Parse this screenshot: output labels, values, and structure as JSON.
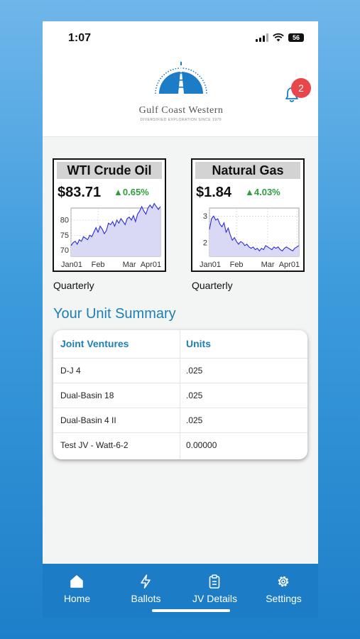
{
  "status_bar": {
    "time": "1:07",
    "battery": "56"
  },
  "header": {
    "logo_name": "Gulf Coast Western",
    "logo_tagline": "DIVERSIFIED EXPLORATION SINCE 1970",
    "notification_count": "2"
  },
  "commodities": [
    {
      "title": "WTI Crude Oil",
      "price": "$83.71",
      "change": "▲0.65%",
      "period": "Quarterly",
      "chart_data": {
        "type": "area",
        "x_tick_labels": [
          "Jan01",
          "Feb",
          "Mar",
          "Apr01"
        ],
        "y_tick_labels": [
          "70",
          "75",
          "80"
        ],
        "ylim": [
          68,
          84
        ],
        "x": [
          "Jan01",
          "",
          "",
          "",
          "",
          "",
          "",
          "",
          "",
          "",
          "",
          "",
          "",
          "Feb",
          "",
          "",
          "",
          "",
          "",
          "",
          "",
          "",
          "",
          "",
          "",
          "",
          "",
          "",
          "Mar",
          "",
          "",
          "",
          "",
          "",
          "",
          "",
          "",
          "",
          "",
          "",
          "",
          "",
          "Apr01"
        ],
        "values": [
          71.5,
          72.5,
          73.0,
          72.0,
          73.5,
          73.0,
          74.5,
          74.0,
          73.5,
          75.0,
          74.5,
          76.0,
          77.5,
          76.0,
          78.0,
          77.0,
          75.5,
          76.5,
          79.0,
          78.5,
          79.5,
          78.0,
          80.0,
          79.0,
          80.5,
          79.5,
          78.5,
          80.5,
          81.0,
          80.0,
          81.5,
          79.5,
          82.0,
          83.0,
          84.5,
          83.0,
          82.0,
          84.0,
          85.0,
          84.0,
          85.5,
          84.5,
          83.5,
          84.5
        ],
        "grid": true,
        "colors": {
          "fill": "#d9d9f5",
          "line": "#2b2bd9"
        }
      }
    },
    {
      "title": "Natural Gas",
      "price": "$1.84",
      "change": "▲4.03%",
      "period": "Quarterly",
      "chart_data": {
        "type": "area",
        "x_tick_labels": [
          "Jan01",
          "Feb",
          "Mar",
          "Apr01"
        ],
        "y_tick_labels": [
          "2",
          "3"
        ],
        "ylim": [
          1.5,
          3.3
        ],
        "x": [
          "Jan01",
          "",
          "",
          "",
          "",
          "",
          "",
          "",
          "",
          "",
          "",
          "",
          "",
          "Feb",
          "",
          "",
          "",
          "",
          "",
          "",
          "",
          "",
          "",
          "",
          "",
          "",
          "",
          "",
          "Mar",
          "",
          "",
          "",
          "",
          "",
          "",
          "",
          "",
          "",
          "",
          "",
          "",
          "",
          "Apr01"
        ],
        "values": [
          2.5,
          2.9,
          3.0,
          2.85,
          2.9,
          2.7,
          2.6,
          2.75,
          2.4,
          2.55,
          2.3,
          2.1,
          2.2,
          2.05,
          1.95,
          2.05,
          2.0,
          1.9,
          1.95,
          1.85,
          1.8,
          1.85,
          1.75,
          1.8,
          1.7,
          1.8,
          1.75,
          1.9,
          1.85,
          1.8,
          1.75,
          1.85,
          1.8,
          1.85,
          1.75,
          1.7,
          1.8,
          1.85,
          1.8,
          1.75,
          1.7,
          1.8,
          1.85,
          1.9
        ],
        "grid": true,
        "colors": {
          "fill": "#d9d9f5",
          "line": "#2b2bd9"
        }
      }
    }
  ],
  "unit_summary": {
    "title": "Your Unit Summary",
    "columns": [
      "Joint Ventures",
      "Units"
    ],
    "rows": [
      [
        "D-J 4",
        ".025"
      ],
      [
        "Dual-Basin 18",
        ".025"
      ],
      [
        "Dual-Basin 4 II",
        ".025"
      ],
      [
        "Test JV - Watt-6-2",
        "0.00000"
      ]
    ]
  },
  "tabs": [
    {
      "label": "Home",
      "icon": "home-icon"
    },
    {
      "label": "Ballots",
      "icon": "lightning-icon"
    },
    {
      "label": "JV Details",
      "icon": "clipboard-icon"
    },
    {
      "label": "Settings",
      "icon": "gear-icon"
    }
  ],
  "colors": {
    "accent": "#1d7fb5",
    "tab_bar": "#1c7dc6",
    "positive": "#2e9e3c",
    "badge": "#e8464a"
  }
}
